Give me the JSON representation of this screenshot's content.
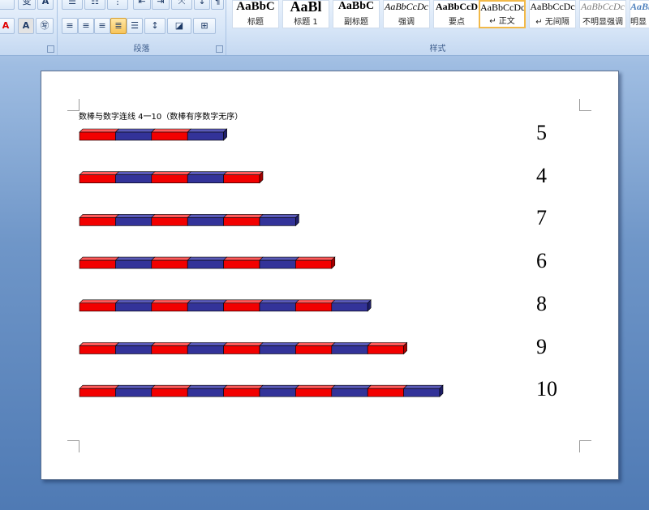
{
  "ribbon": {
    "groups": [
      {
        "name": "paragraph",
        "label": "段落"
      },
      {
        "name": "styles",
        "label": "样式"
      }
    ],
    "font_buttons": [
      "变",
      "A",
      "A",
      "㊢"
    ],
    "styles": [
      {
        "preview": "AaBbC",
        "name": "标题"
      },
      {
        "preview": "AaBl",
        "name": "标题 1"
      },
      {
        "preview": "AaBbC",
        "name": "副标题"
      },
      {
        "preview": "AaBbCcDc",
        "name": "强调"
      },
      {
        "preview": "AaBbCcD",
        "name": "要点"
      },
      {
        "preview": "AaBbCcDc",
        "name": "↵ 正文"
      },
      {
        "preview": "AaBbCcDc",
        "name": "↵ 无间隔"
      },
      {
        "preview": "AaBbCcDc",
        "name": "不明显强调"
      },
      {
        "preview": "AaBb",
        "name": "明显"
      }
    ],
    "colors": {
      "accent_selected": "#f2b948"
    }
  },
  "document": {
    "title": "数棒与数字连线 4一10（数棒有序数字无序）",
    "rows": [
      {
        "segments": 4,
        "label": "5"
      },
      {
        "segments": 5,
        "label": "4"
      },
      {
        "segments": 6,
        "label": "7"
      },
      {
        "segments": 7,
        "label": "6"
      },
      {
        "segments": 8,
        "label": "8"
      },
      {
        "segments": 9,
        "label": "9"
      },
      {
        "segments": 10,
        "label": "10"
      }
    ],
    "colors": {
      "red": "#f20000",
      "blue": "#333399"
    }
  }
}
